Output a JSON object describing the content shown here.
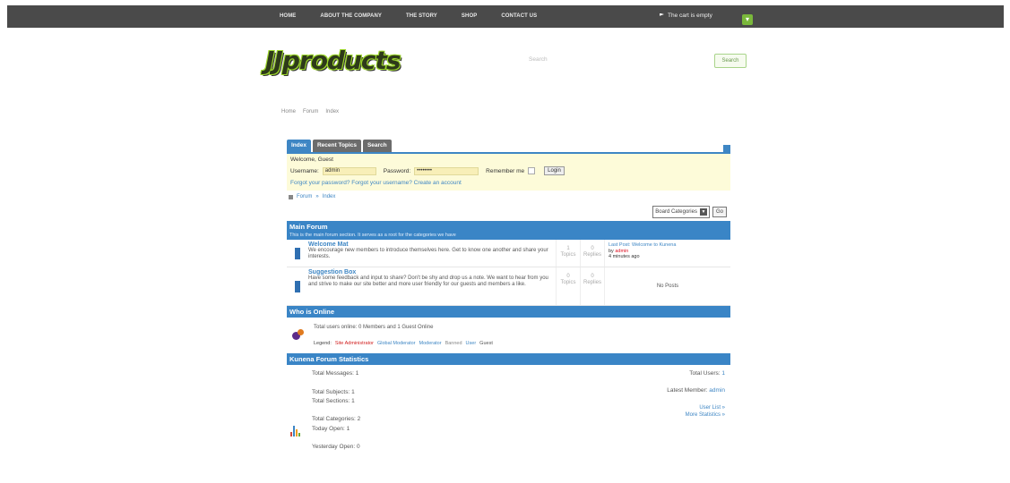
{
  "nav": {
    "items": [
      "HOME",
      "ABOUT THE COMPANY",
      "THE STORY",
      "SHOP",
      "CONTACT US"
    ],
    "cart_text": "The cart is empty"
  },
  "header": {
    "logo_text": "JJproducts",
    "search_placeholder": "Search",
    "search_button": "Search"
  },
  "breadcrumb": [
    "Home",
    "Forum",
    "Index"
  ],
  "tabs": [
    "Index",
    "Recent Topics",
    "Search"
  ],
  "login": {
    "welcome": "Welcome, Guest",
    "username_label": "Username:",
    "username_value": "admin",
    "password_label": "Password:",
    "password_value": "••••••••",
    "remember_label": "Remember me",
    "login_button": "Login",
    "links": "Forgot your password? Forgot your username? Create an account"
  },
  "forum_crumb": [
    "Forum",
    "Index"
  ],
  "tools": {
    "select_value": "Board Categories",
    "go_label": "Go"
  },
  "main_forum": {
    "title": "Main Forum",
    "subtitle": "This is the main forum section. It serves as a root for the categories we have",
    "categories": [
      {
        "title": "Welcome Mat",
        "desc": "We encourage new members to introduce themselves here. Get to know one another and share your interests.",
        "topics": "1",
        "topics_label": "Topics",
        "replies": "0",
        "replies_label": "Replies",
        "last_post": "Last Post: Welcome to Kunena",
        "last_by_prefix": "by",
        "last_by": "admin",
        "last_time": "4 minutes ago"
      },
      {
        "title": "Suggestion Box",
        "desc": "Have some feedback and input to share? Don't be shy and drop us a note. We want to hear from you and strive to make our site better and more user friendly for our guests and members a like.",
        "topics": "0",
        "topics_label": "Topics",
        "replies": "0",
        "replies_label": "Replies",
        "no_posts": "No Posts"
      }
    ]
  },
  "online": {
    "title": "Who is Online",
    "text": "Total users online: 0 Members and 1 Guest Online",
    "legend_label": "Legend:",
    "legend": [
      {
        "label": "Site Administrator",
        "color": "#d12020"
      },
      {
        "label": "Global Moderator",
        "color": "#3e86c4"
      },
      {
        "label": "Moderator",
        "color": "#3e86c4"
      },
      {
        "label": "Banned",
        "color": "#888888"
      },
      {
        "label": "User",
        "color": "#3e86c4"
      },
      {
        "label": "Guest",
        "color": "#555555"
      }
    ]
  },
  "stats": {
    "title": "Kunena Forum Statistics",
    "total_messages": "Total Messages: 1",
    "total_subjects": "Total Subjects: 1",
    "total_sections": "Total Sections: 1",
    "total_categories": "Total Categories: 2",
    "today_open": "Today Open: 1",
    "yesterday_open": "Yesterday Open: 0",
    "total_users_label": "Total Users:",
    "total_users_value": "1",
    "latest_member_label": "Latest Member:",
    "latest_member_value": "admin",
    "user_list": "User List »",
    "more_stats": "More Statistics »"
  }
}
